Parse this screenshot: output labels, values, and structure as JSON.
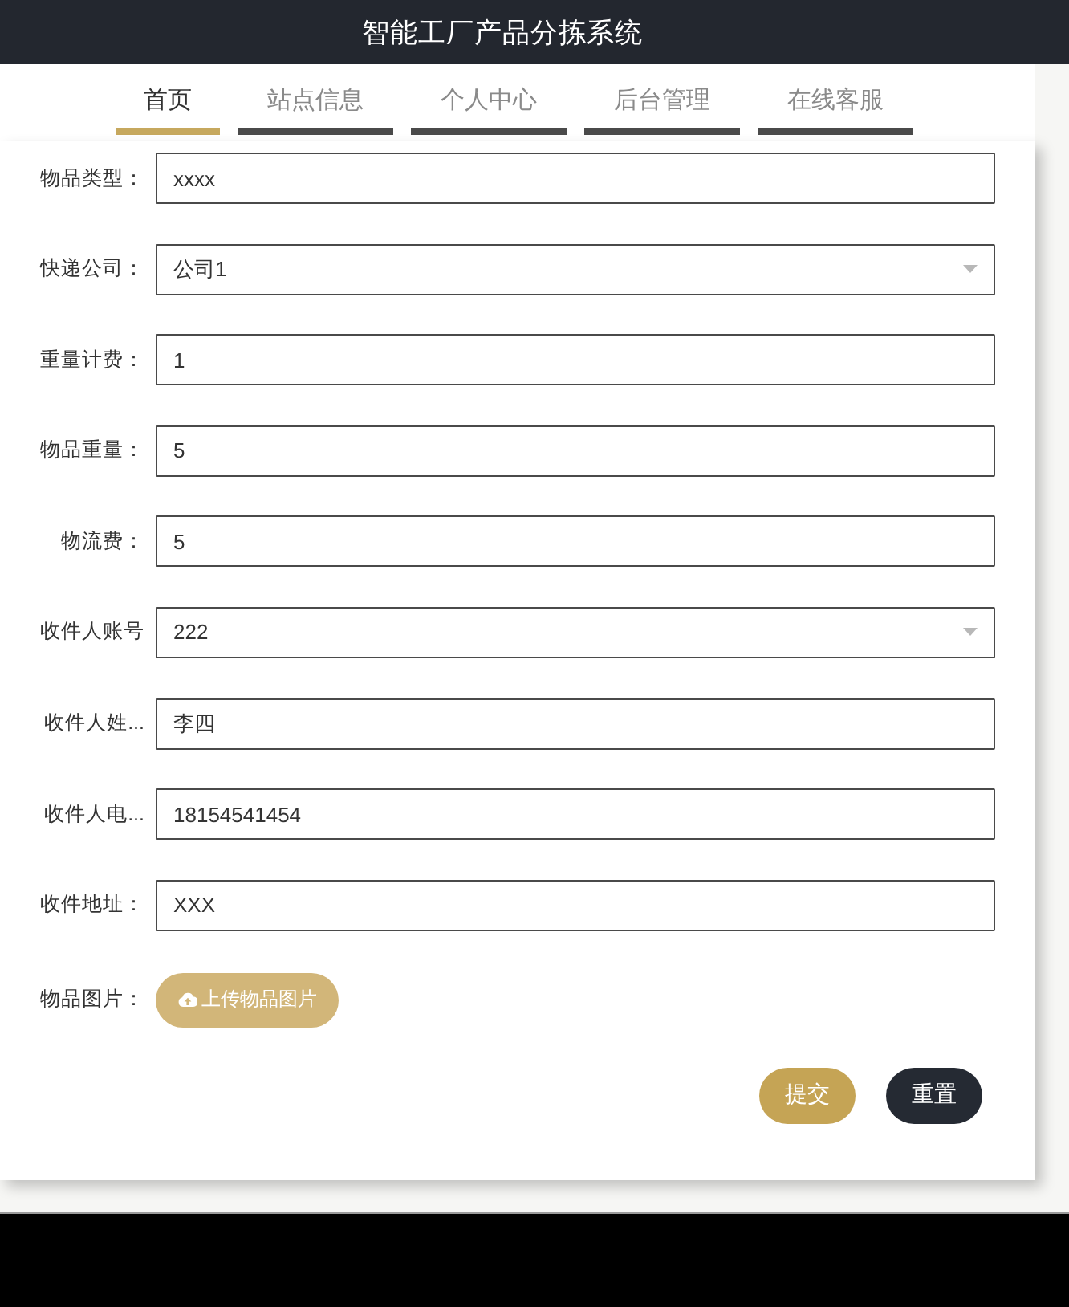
{
  "header": {
    "title": "智能工厂产品分拣系统"
  },
  "nav": {
    "tabs": [
      {
        "label": "首页",
        "selected": true
      },
      {
        "label": "站点信息",
        "selected": false
      },
      {
        "label": "个人中心",
        "selected": false
      },
      {
        "label": "后台管理",
        "selected": false
      },
      {
        "label": "在线客服",
        "selected": false
      }
    ]
  },
  "form": {
    "fields": [
      {
        "label": "物品类型：",
        "kind": "text",
        "value": "xxxx"
      },
      {
        "label": "快递公司：",
        "kind": "select",
        "value": "公司1"
      },
      {
        "label": "重量计费：",
        "kind": "text",
        "value": "1"
      },
      {
        "label": "物品重量：",
        "kind": "text",
        "value": "5"
      },
      {
        "label": "物流费：",
        "kind": "text",
        "value": "5"
      },
      {
        "label": "收件人账号",
        "kind": "select",
        "value": "222"
      },
      {
        "label": "收件人姓...",
        "kind": "text",
        "value": "李四"
      },
      {
        "label": "收件人电...",
        "kind": "text",
        "value": "18154541454"
      },
      {
        "label": "收件地址：",
        "kind": "text",
        "value": "XXX"
      },
      {
        "label": "物品图片：",
        "kind": "upload",
        "button": "上传物品图片"
      }
    ],
    "actions": [
      {
        "label": "提交",
        "kind": "primary"
      },
      {
        "label": "重置",
        "kind": "secondary"
      }
    ]
  }
}
